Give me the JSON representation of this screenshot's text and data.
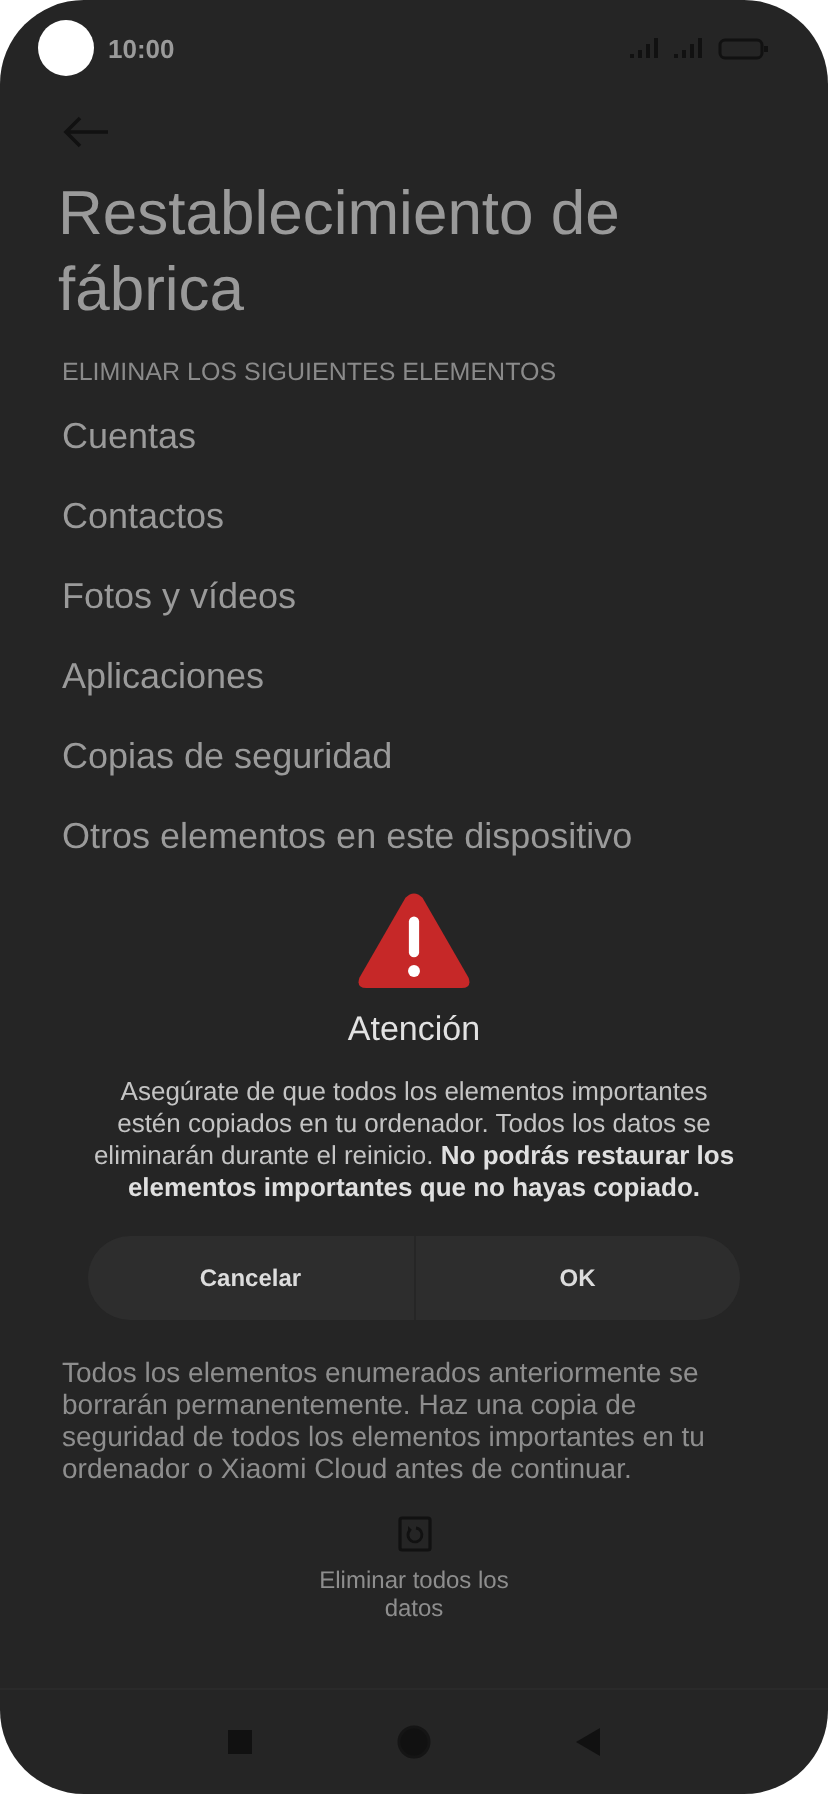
{
  "status_bar": {
    "time": "10:00"
  },
  "header": {
    "title": "Restablecimiento de fábrica"
  },
  "section_label": "ELIMINAR LOS SIGUIENTES ELEMENTOS",
  "items": [
    {
      "label": "Cuentas"
    },
    {
      "label": "Contactos"
    },
    {
      "label": "Fotos y vídeos"
    },
    {
      "label": "Aplicaciones"
    },
    {
      "label": "Copias de seguridad"
    },
    {
      "label": "Otros elementos en este dispositivo"
    }
  ],
  "note": "Todos los elementos enumerados anteriormente se borrarán permanentemente. Haz una copia de seguridad de todos los elementos importantes en tu ordenador o Xiaomi Cloud antes de continuar.",
  "action": {
    "label": "Eliminar todos los datos"
  },
  "dialog": {
    "title": "Atención",
    "message": "Asegúrate de que todos los elementos importantes estén copiados en tu ordenador. Todos los datos se eliminarán durante el reinicio. **No podrás restaurar los elementos importantes que no hayas copiado.**",
    "buttons": [
      {
        "label": "Cancelar"
      },
      {
        "label": "OK"
      }
    ]
  }
}
